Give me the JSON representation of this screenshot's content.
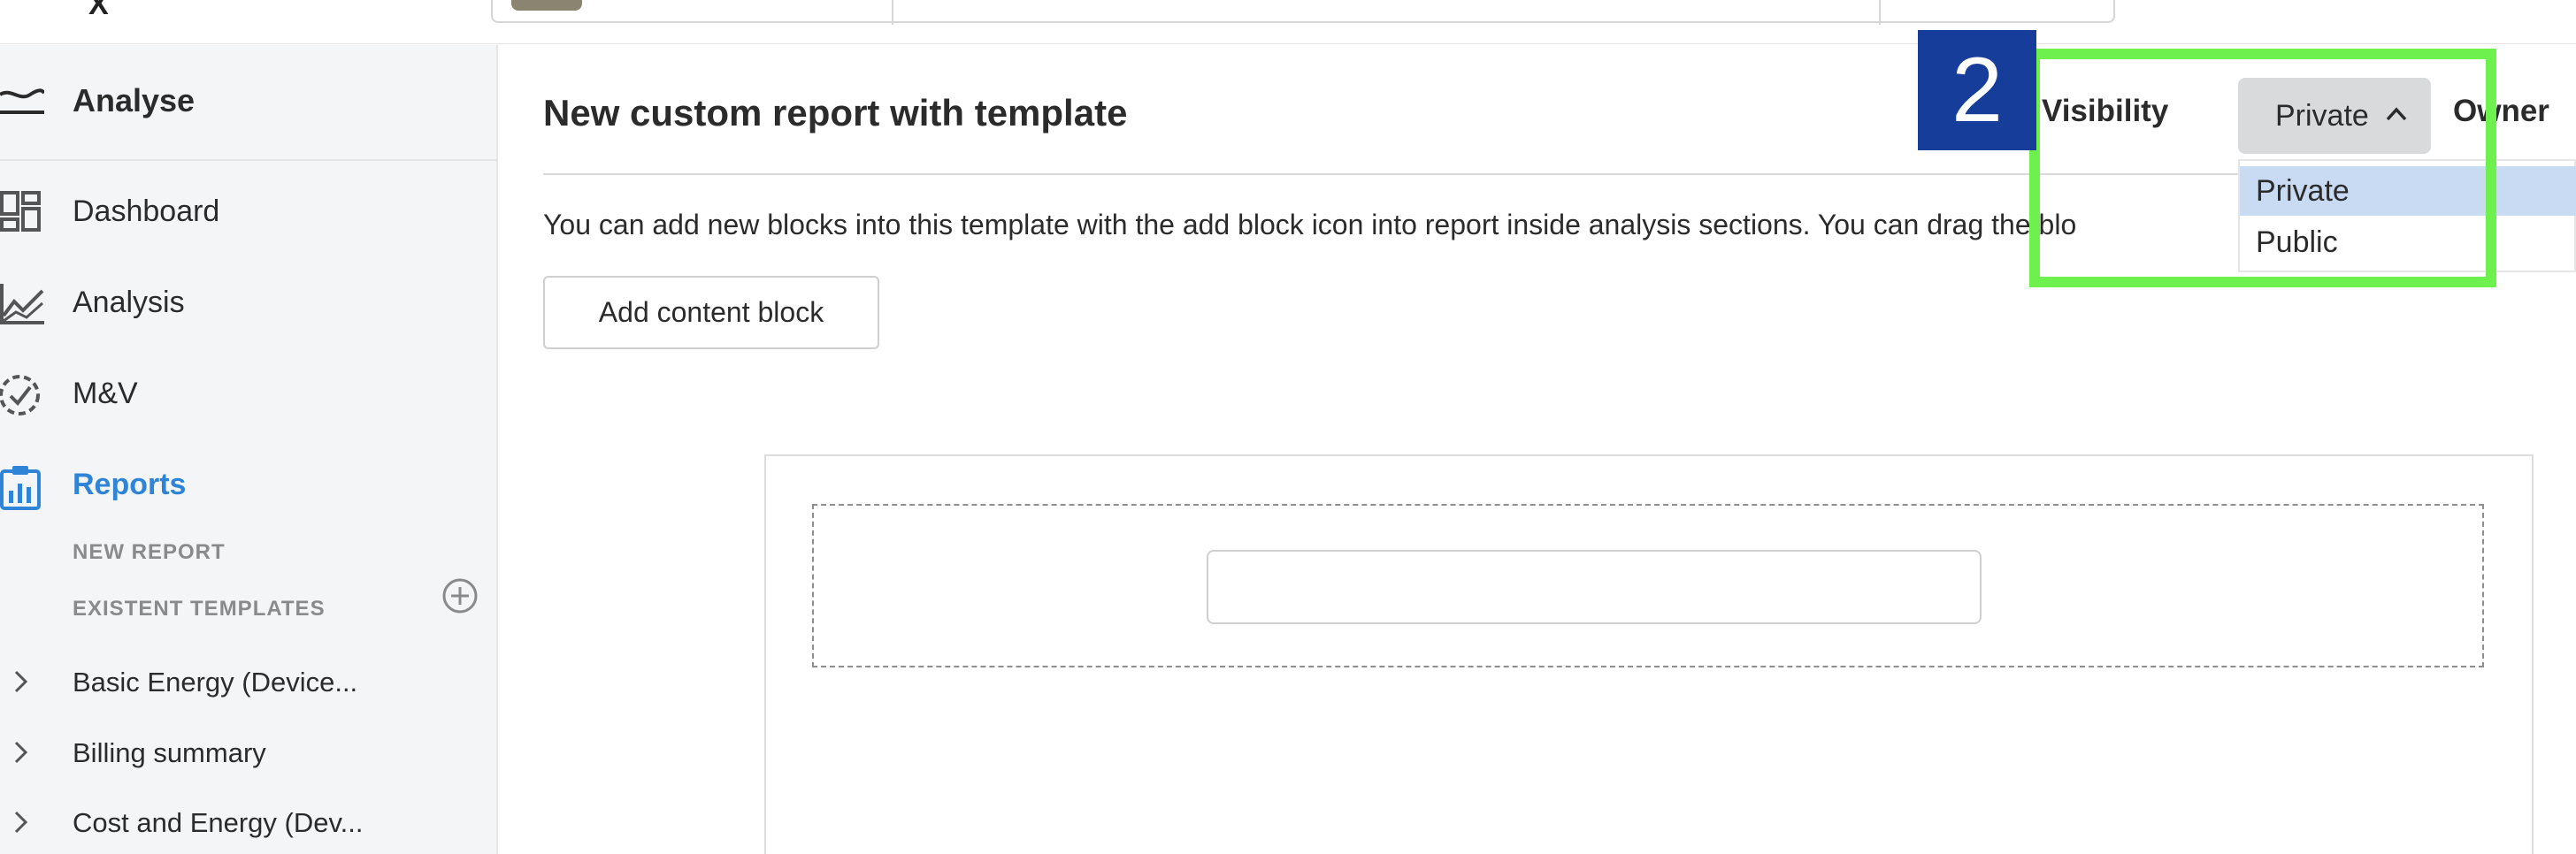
{
  "topbar": {
    "logo_fragment": "X"
  },
  "sidebar": {
    "section_title": "Analyse",
    "items": [
      {
        "label": "Dashboard",
        "icon": "dashboard-icon"
      },
      {
        "label": "Analysis",
        "icon": "line-chart-icon"
      },
      {
        "label": "M&V",
        "icon": "check-circle-icon"
      },
      {
        "label": "Reports",
        "icon": "clipboard-icon",
        "active": true
      }
    ],
    "new_report_label": "NEW REPORT",
    "existent_templates_label": "EXISTENT TEMPLATES",
    "templates": [
      {
        "label": "Basic Energy (Device..."
      },
      {
        "label": "Billing summary"
      },
      {
        "label": "Cost and Energy (Dev..."
      }
    ]
  },
  "main": {
    "title": "New custom report with template",
    "description": "You can add new blocks into this template with the add block icon into report inside analysis sections. You can drag the blo",
    "add_block_label": "Add content block",
    "drop_input_value": ""
  },
  "visibility": {
    "label": "Visibility",
    "selected": "Private",
    "options": [
      "Private",
      "Public"
    ],
    "owner_label": "Owner"
  },
  "annotation": {
    "badge_number": "2"
  },
  "colors": {
    "accent": "#2f84d8",
    "sidebar_bg": "#f4f5f7",
    "highlight": "#6ef04e",
    "badge_bg": "#173d9b",
    "option_selected_bg": "#c8dbf3"
  }
}
